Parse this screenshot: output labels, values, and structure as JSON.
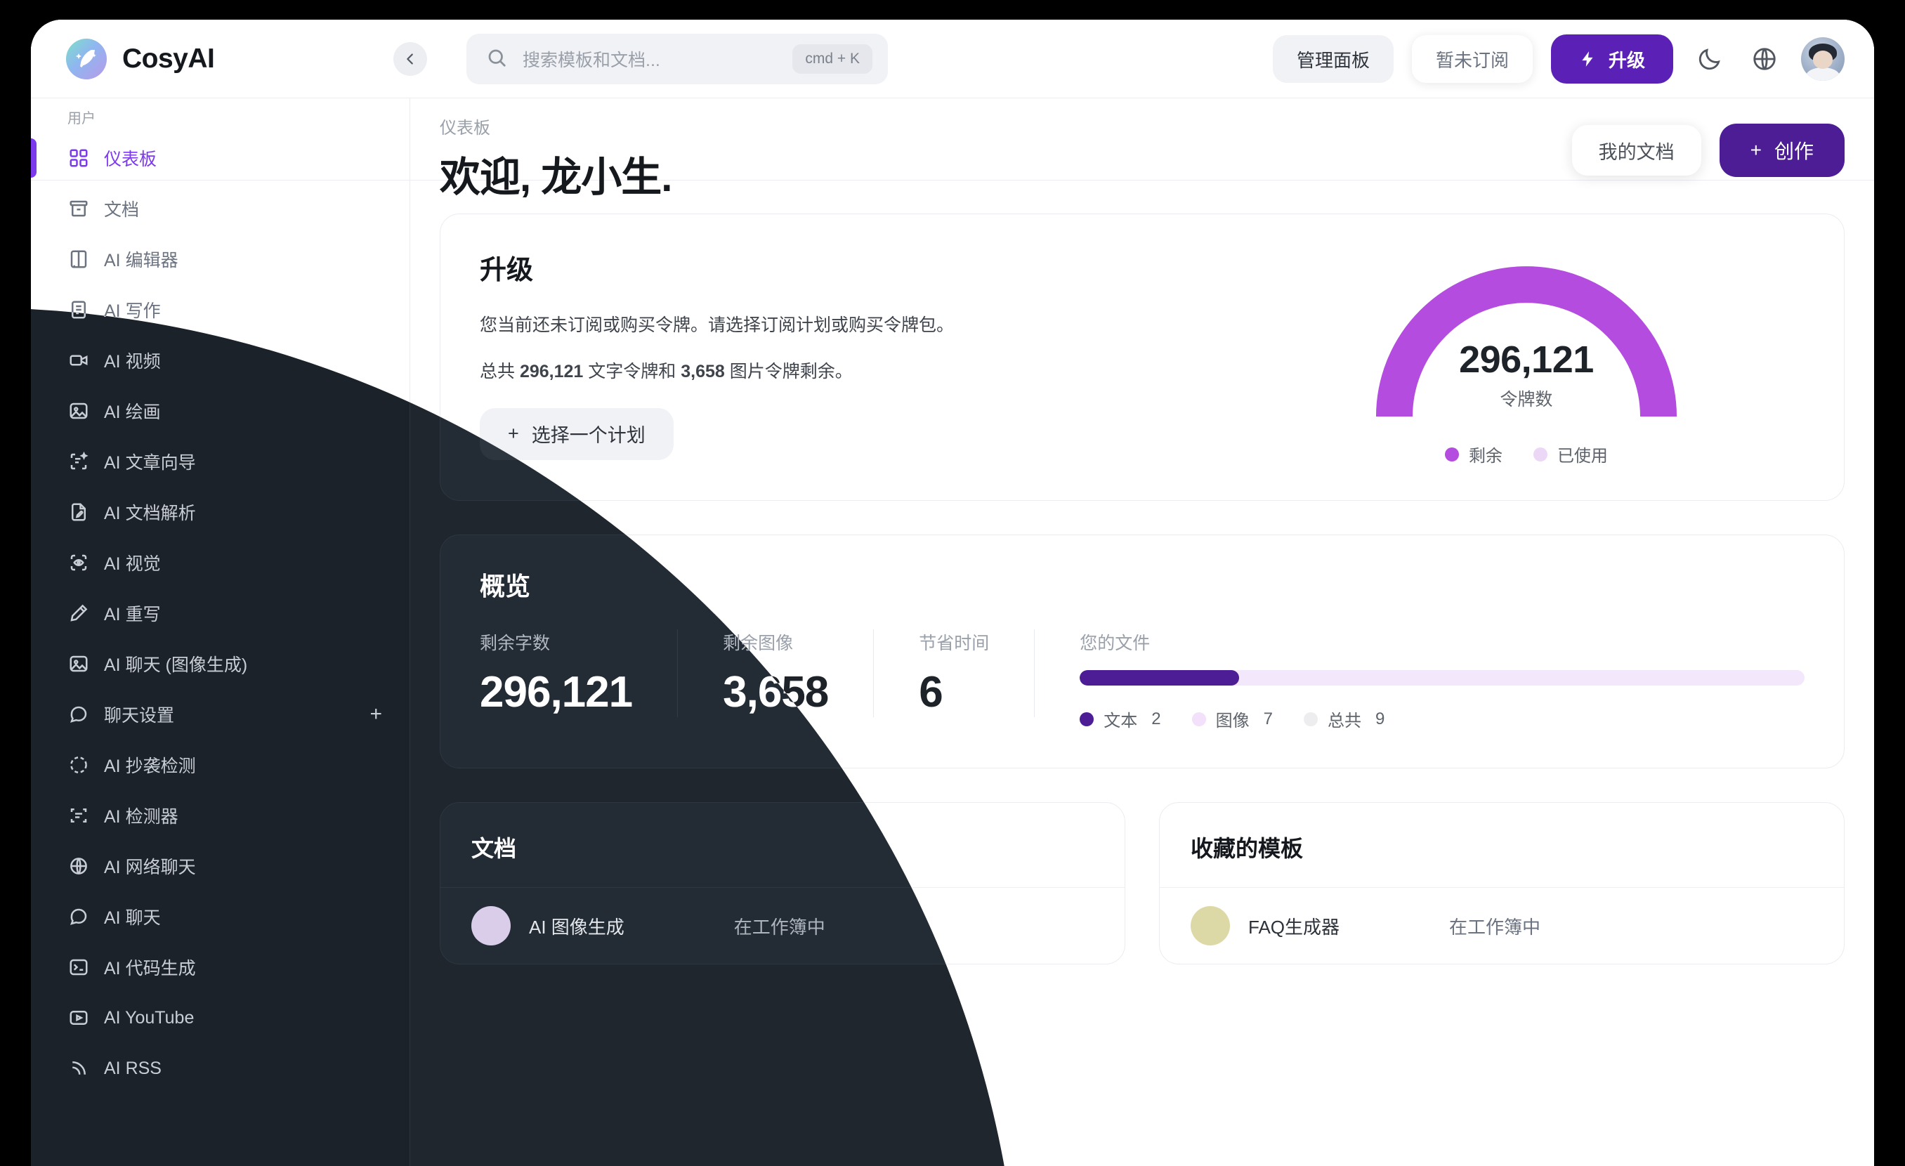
{
  "brand": {
    "name": "CosyAI",
    "logo_icon": "feather-sparkle-icon"
  },
  "sidebar": {
    "section_label": "用户",
    "items": [
      {
        "label": "仪表板",
        "icon": "grid-dashboard-icon",
        "active": true
      },
      {
        "label": "文档",
        "icon": "archive-box-icon",
        "active": false
      },
      {
        "label": "AI 编辑器",
        "icon": "book-open-icon",
        "active": false
      },
      {
        "label": "AI 写作",
        "icon": "document-lines-icon",
        "active": false
      },
      {
        "label": "AI 视频",
        "icon": "video-camera-icon",
        "active": false
      },
      {
        "label": "AI 绘画",
        "icon": "image-icon",
        "active": false
      },
      {
        "label": "AI 文章向导",
        "icon": "article-wizard-icon",
        "active": false
      },
      {
        "label": "AI 文档解析",
        "icon": "document-pencil-icon",
        "active": false
      },
      {
        "label": "AI 视觉",
        "icon": "eye-scan-icon",
        "active": false
      },
      {
        "label": "AI 重写",
        "icon": "pencil-icon",
        "active": false
      },
      {
        "label": "AI 聊天 (图像生成)",
        "icon": "image-icon",
        "active": false
      },
      {
        "label": "聊天设置",
        "icon": "chat-bubble-icon",
        "active": false,
        "trailing": "+"
      },
      {
        "label": "AI 抄袭检测",
        "icon": "check-dashed-circle-icon",
        "active": false
      },
      {
        "label": "AI 检测器",
        "icon": "scan-text-icon",
        "active": false
      },
      {
        "label": "AI 网络聊天",
        "icon": "globe-www-icon",
        "active": false
      },
      {
        "label": "AI 聊天",
        "icon": "chat-dots-icon",
        "active": false
      },
      {
        "label": "AI 代码生成",
        "icon": "terminal-icon",
        "active": false
      },
      {
        "label": "AI YouTube",
        "icon": "play-box-icon",
        "active": false
      },
      {
        "label": "AI RSS",
        "icon": "rss-icon",
        "active": false
      }
    ]
  },
  "topbar": {
    "collapse_icon": "chevron-left-icon",
    "search": {
      "icon": "search-icon",
      "placeholder": "搜索模板和文档...",
      "shortcut": "cmd + K"
    },
    "admin_label": "管理面板",
    "subscription_label": "暂未订阅",
    "upgrade_label": "升级",
    "upgrade_icon": "lightning-bolt-icon",
    "theme_icon": "moon-icon",
    "language_icon": "globe-icon",
    "avatar_name": "avatar"
  },
  "welcome": {
    "breadcrumb": "仪表板",
    "title": "欢迎, 龙小生.",
    "my_docs_label": "我的文档",
    "create_label": "创作",
    "create_icon": "plus-icon"
  },
  "upgrade_card": {
    "title": "升级",
    "description": "您当前还未订阅或购买令牌。请选择订阅计划或购买令牌包。",
    "total_prefix": "总共 ",
    "total_text_tokens": "296,121",
    "total_mid": " 文字令牌和 ",
    "total_image_tokens": "3,658",
    "total_suffix": " 图片令牌剩余。",
    "choose_plan_label": "选择一个计划",
    "choose_plan_icon": "plus-icon"
  },
  "overview": {
    "title": "概览",
    "stats": [
      {
        "label": "剩余字数",
        "value": "296,121"
      },
      {
        "label": "剩余图像",
        "value": "3,658"
      },
      {
        "label": "节省时间",
        "value": "6"
      }
    ],
    "files": {
      "label": "您的文件",
      "legend": [
        {
          "label": "文本",
          "value": "2",
          "color": "#4c1d95"
        },
        {
          "label": "图像",
          "value": "7",
          "color": "#f3e0fb"
        },
        {
          "label": "总共",
          "value": "9",
          "color": "#ededf0"
        }
      ]
    }
  },
  "bottom": {
    "documents": {
      "title": "文档",
      "rows": [
        {
          "name": "AI 图像生成",
          "status": "在工作簿中",
          "color": "#d9cdea"
        }
      ]
    },
    "templates": {
      "title": "收藏的模板",
      "rows": [
        {
          "name": "FAQ生成器",
          "status": "在工作簿中",
          "color": "#ddd9a6"
        }
      ]
    }
  },
  "chart_data": [
    {
      "type": "pie",
      "title": "令牌数",
      "subtype": "half-donut-gauge",
      "center_value": "296,121",
      "center_label": "令牌数",
      "categories": [
        "剩余",
        "已使用"
      ],
      "values": [
        296121,
        0
      ],
      "colors": [
        "#b44ce0",
        "#ecd8f6"
      ],
      "legend": [
        "剩余",
        "已使用"
      ],
      "legend_position": "bottom"
    },
    {
      "type": "bar",
      "subtype": "stacked-progress",
      "title": "您的文件",
      "categories": [
        "文本",
        "图像",
        "总共"
      ],
      "values": [
        2,
        7,
        9
      ],
      "colors": [
        "#4c1d95",
        "#f3e0fb",
        "#ededf0"
      ],
      "fill_percent": 22,
      "ylim": [
        0,
        9
      ]
    }
  ],
  "colors": {
    "accent_purple": "#5b21b6",
    "accent_violet": "#4c1d95",
    "gauge_purple": "#b44ce0",
    "gauge_track": "#ecd8f6",
    "dark_bg": "#1f262e",
    "dark_sidebar": "#1b222a",
    "sidebar_active_dark": "#b362e8"
  }
}
